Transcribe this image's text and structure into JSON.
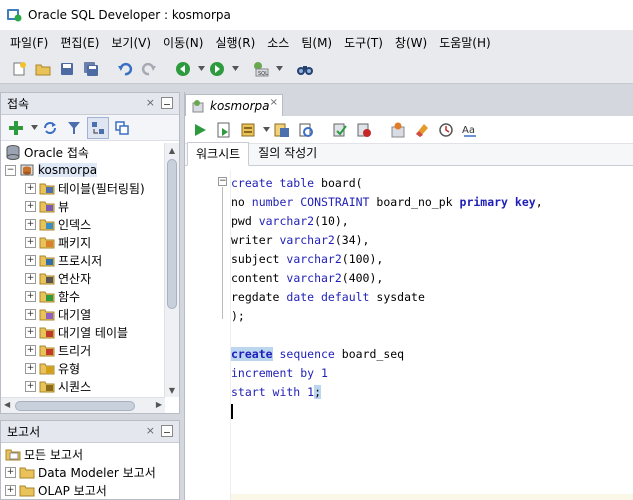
{
  "window": {
    "title": "Oracle SQL Developer : kosmorpa"
  },
  "menu": [
    "파일(F)",
    "편집(E)",
    "보기(V)",
    "이동(N)",
    "실행(R)",
    "소스",
    "팀(M)",
    "도구(T)",
    "창(W)",
    "도움말(H)"
  ],
  "connections_panel": {
    "title": "접속",
    "close": "×",
    "tree": [
      {
        "label": "Oracle 접속",
        "level": 0,
        "expander": "",
        "icon": "database-icon"
      },
      {
        "label": "kosmorpa",
        "level": 0,
        "expander": "−",
        "icon": "connection-icon",
        "selected": true
      },
      {
        "label": "테이블(필터링됨)",
        "level": 1,
        "expander": "+",
        "icon": "table-folder-icon"
      },
      {
        "label": "뷰",
        "level": 1,
        "expander": "+",
        "icon": "view-folder-icon"
      },
      {
        "label": "인덱스",
        "level": 1,
        "expander": "+",
        "icon": "index-folder-icon"
      },
      {
        "label": "패키지",
        "level": 1,
        "expander": "+",
        "icon": "package-folder-icon"
      },
      {
        "label": "프로시저",
        "level": 1,
        "expander": "+",
        "icon": "procedure-folder-icon"
      },
      {
        "label": "연산자",
        "level": 1,
        "expander": "+",
        "icon": "operator-folder-icon"
      },
      {
        "label": "함수",
        "level": 1,
        "expander": "+",
        "icon": "function-folder-icon"
      },
      {
        "label": "대기열",
        "level": 1,
        "expander": "+",
        "icon": "queue-folder-icon"
      },
      {
        "label": "대기열 테이블",
        "level": 1,
        "expander": "+",
        "icon": "queue-table-folder-icon"
      },
      {
        "label": "트리거",
        "level": 1,
        "expander": "+",
        "icon": "trigger-folder-icon"
      },
      {
        "label": "유형",
        "level": 1,
        "expander": "+",
        "icon": "type-folder-icon"
      },
      {
        "label": "시퀀스",
        "level": 1,
        "expander": "+",
        "icon": "sequence-folder-icon"
      }
    ]
  },
  "reports_panel": {
    "title": "보고서",
    "close": "×",
    "tree": [
      {
        "label": "모든 보고서",
        "expander": "",
        "icon": "reports-folder-icon"
      },
      {
        "label": "Data Modeler 보고서",
        "expander": "+",
        "icon": "folder-icon"
      },
      {
        "label": "OLAP 보고서",
        "expander": "+",
        "icon": "folder-icon"
      }
    ]
  },
  "editor": {
    "tab_label": "kosmorpa",
    "tab_close": "×",
    "subtabs": [
      "워크시트",
      "질의 작성기"
    ],
    "active_subtab": 0,
    "fold_marker": "−",
    "code_lines": [
      [
        {
          "t": "create table ",
          "c": "kw"
        },
        {
          "t": "board(",
          "c": "plain"
        }
      ],
      [
        {
          "t": "no ",
          "c": "plain"
        },
        {
          "t": "number ",
          "c": "kw"
        },
        {
          "t": "CONSTRAINT ",
          "c": "kw"
        },
        {
          "t": "board_no_pk ",
          "c": "plain"
        },
        {
          "t": "primary key",
          "c": "kwb"
        },
        {
          "t": ",",
          "c": "plain"
        }
      ],
      [
        {
          "t": "pwd ",
          "c": "plain"
        },
        {
          "t": "varchar2",
          "c": "kw"
        },
        {
          "t": "(10),",
          "c": "plain"
        }
      ],
      [
        {
          "t": "writer ",
          "c": "plain"
        },
        {
          "t": "varchar2",
          "c": "kw"
        },
        {
          "t": "(34),",
          "c": "plain"
        }
      ],
      [
        {
          "t": "subject ",
          "c": "plain"
        },
        {
          "t": "varchar2",
          "c": "kw"
        },
        {
          "t": "(100),",
          "c": "plain"
        }
      ],
      [
        {
          "t": "content ",
          "c": "plain"
        },
        {
          "t": "varchar2",
          "c": "kw"
        },
        {
          "t": "(400),",
          "c": "plain"
        }
      ],
      [
        {
          "t": "regdate ",
          "c": "plain"
        },
        {
          "t": "date default ",
          "c": "kw"
        },
        {
          "t": "sysdate",
          "c": "plain"
        }
      ],
      [
        {
          "t": ");",
          "c": "plain"
        }
      ],
      [],
      [
        {
          "t": "create",
          "c": "kwb hl"
        },
        {
          "t": " sequence ",
          "c": "kw"
        },
        {
          "t": "board_seq",
          "c": "plain"
        }
      ],
      [
        {
          "t": "increment by ",
          "c": "kw"
        },
        {
          "t": "1",
          "c": "num"
        }
      ],
      [
        {
          "t": "start with ",
          "c": "kw"
        },
        {
          "t": "1",
          "c": "num"
        },
        {
          "t": ";",
          "c": "plain hl"
        }
      ]
    ]
  },
  "colors": {
    "keyword": "#1f1fb8",
    "selection": "#bcd6f0",
    "current_line": "#fbf7e7"
  }
}
